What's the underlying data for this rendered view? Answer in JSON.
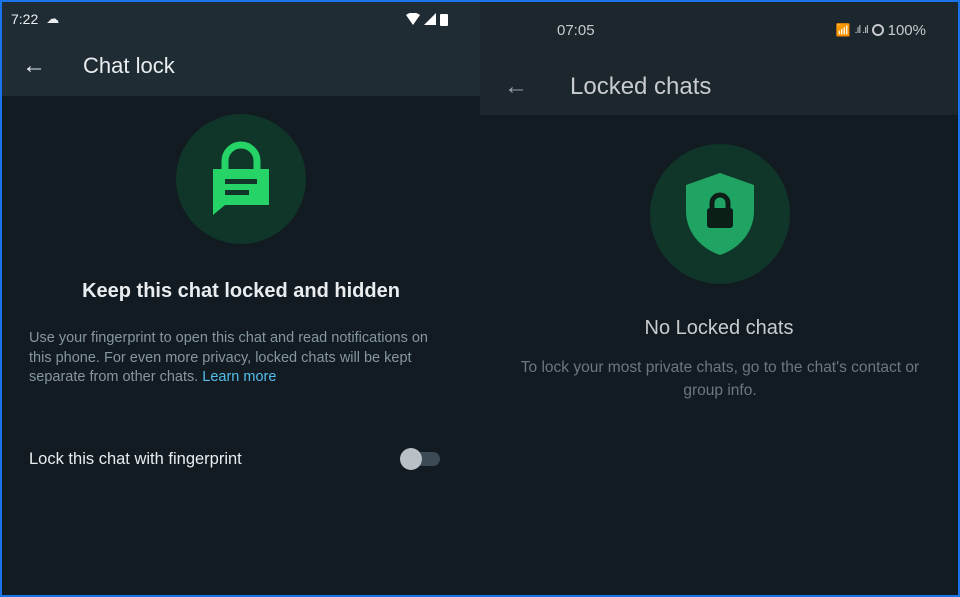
{
  "left": {
    "status": {
      "time": "7:22",
      "icons": [
        "cloud-icon",
        "wifi-icon",
        "signal-icon",
        "battery-icon"
      ]
    },
    "title": "Chat lock",
    "heading": "Keep this chat locked and hidden",
    "description": "Use your fingerprint to open this chat and read notifications on this phone. For even more privacy, locked chats will be kept separate from other chats.",
    "learn_more": "Learn more",
    "toggle_label": "Lock this chat with fingerprint",
    "toggle_on": false
  },
  "right": {
    "status": {
      "time": "07:05",
      "battery": "100%"
    },
    "title": "Locked chats",
    "heading": "No Locked chats",
    "description": "To lock your most private chats, go to the chat's contact or group info."
  },
  "colors": {
    "accent": "#25d366",
    "link": "#53bdeb",
    "bg": "#121b22"
  }
}
